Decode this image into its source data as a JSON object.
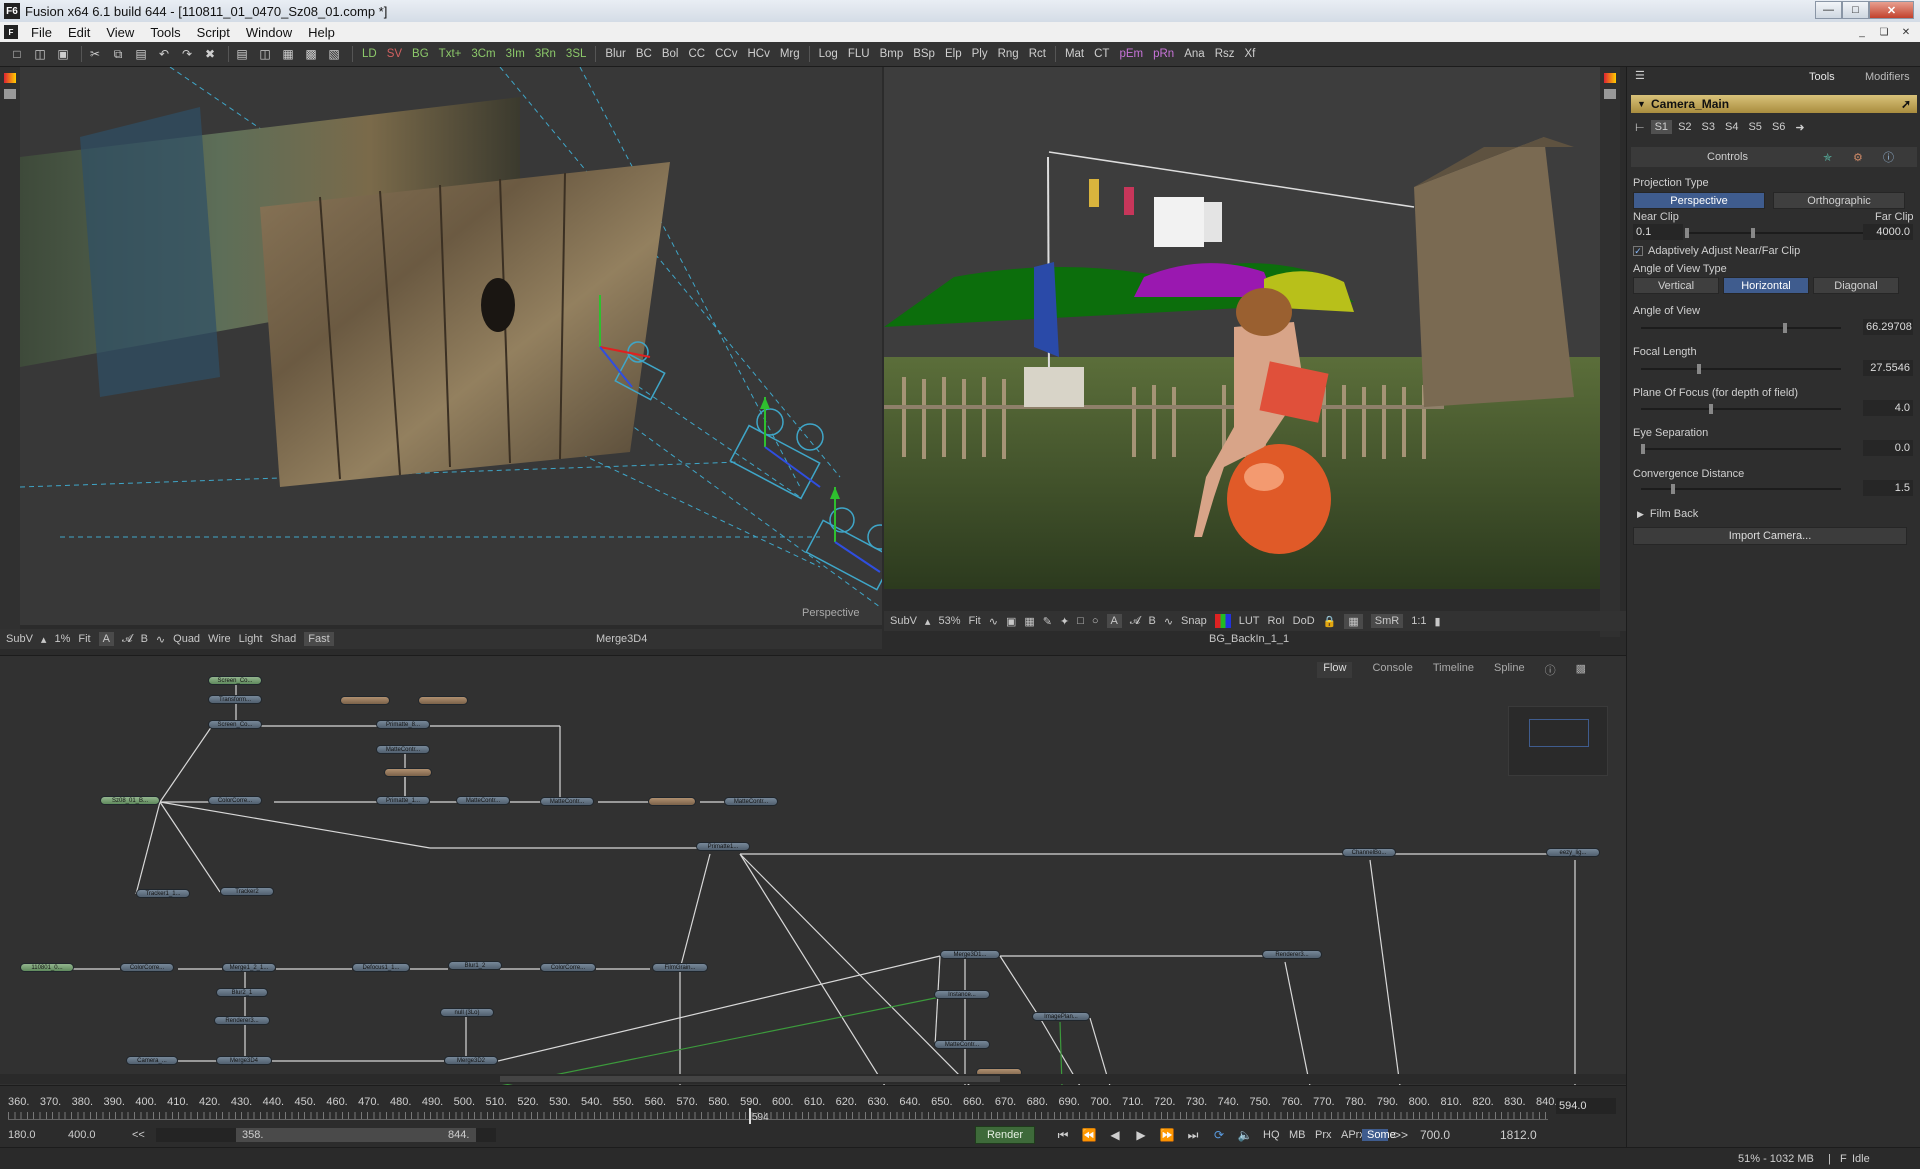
{
  "window": {
    "title": "Fusion x64 6.1 build 644 - [110811_01_0470_Sz08_01.comp *]",
    "app_icon": "F6"
  },
  "menu": [
    "File",
    "Edit",
    "View",
    "Tools",
    "Script",
    "Window",
    "Help"
  ],
  "toolbar": {
    "tools": [
      {
        "label": "LD",
        "tint": "green"
      },
      {
        "label": "SV",
        "tint": "red"
      },
      {
        "label": "BG",
        "tint": "green"
      },
      {
        "label": "Txt+",
        "tint": "green"
      },
      {
        "label": "3Cm",
        "tint": "green"
      },
      {
        "label": "3Im",
        "tint": "green"
      },
      {
        "label": "3Rn",
        "tint": "green"
      },
      {
        "label": "3SL",
        "tint": "green"
      },
      {
        "label": "Blur",
        "tint": ""
      },
      {
        "label": "BC",
        "tint": ""
      },
      {
        "label": "Bol",
        "tint": ""
      },
      {
        "label": "CC",
        "tint": ""
      },
      {
        "label": "CCv",
        "tint": ""
      },
      {
        "label": "HCv",
        "tint": ""
      },
      {
        "label": "Mrg",
        "tint": ""
      },
      {
        "label": "Log",
        "tint": ""
      },
      {
        "label": "FLU",
        "tint": ""
      },
      {
        "label": "Bmp",
        "tint": ""
      },
      {
        "label": "BSp",
        "tint": ""
      },
      {
        "label": "Elp",
        "tint": ""
      },
      {
        "label": "Ply",
        "tint": ""
      },
      {
        "label": "Rng",
        "tint": ""
      },
      {
        "label": "Rct",
        "tint": ""
      },
      {
        "label": "Mat",
        "tint": ""
      },
      {
        "label": "CT",
        "tint": ""
      },
      {
        "label": "pEm",
        "tint": "magenta"
      },
      {
        "label": "pRn",
        "tint": "magenta"
      },
      {
        "label": "Ana",
        "tint": ""
      },
      {
        "label": "Rsz",
        "tint": ""
      },
      {
        "label": "Xf",
        "tint": ""
      }
    ]
  },
  "viewer_left": {
    "label_perspective": "Perspective",
    "bar": {
      "subv": "SubV",
      "zoom": "1%",
      "fit": "Fit",
      "quad": "Quad",
      "wire": "Wire",
      "light": "Light",
      "shad": "Shad",
      "fast": "Fast"
    },
    "viewing": "Merge3D4"
  },
  "viewer_right": {
    "bar": {
      "subv": "SubV",
      "zoom": "53%",
      "fit": "Fit",
      "snap": "Snap",
      "lut": "LUT",
      "roi": "RoI",
      "dod": "DoD",
      "smr": "SmR",
      "ratio": "1:1"
    },
    "viewing": "BG_BackIn_1_1"
  },
  "panel": {
    "tabs": [
      "Tools",
      "Modifiers"
    ],
    "tool_name": "Camera_Main",
    "slots": [
      "S1",
      "S2",
      "S3",
      "S4",
      "S5",
      "S6"
    ],
    "controls_tab": "Controls",
    "projection_type": "Projection Type",
    "perspective": "Perspective",
    "orthographic": "Orthographic",
    "near_clip": "Near Clip",
    "far_clip": "Far Clip",
    "near_clip_value": "0.1",
    "far_clip_value": "4000.0",
    "adaptive": "Adaptively Adjust Near/Far Clip",
    "aov_type": "Angle of View Type",
    "vertical": "Vertical",
    "horizontal": "Horizontal",
    "diagonal": "Diagonal",
    "angle_of_view": "Angle of View",
    "angle_of_view_value": "66.29708",
    "focal_length": "Focal Length",
    "focal_length_value": "27.5546",
    "plane_of_focus": "Plane Of Focus (for depth of field)",
    "plane_of_focus_value": "4.0",
    "eye_separation": "Eye Separation",
    "eye_separation_value": "0.0",
    "convergence": "Convergence Distance",
    "convergence_value": "1.5",
    "film_back": "Film Back",
    "import_camera": "Import Camera..."
  },
  "flow": {
    "tabs": [
      "Flow",
      "Console",
      "Timeline",
      "Spline"
    ],
    "nodes": [
      {
        "label": "Screen_Co...",
        "tint": "green"
      },
      {
        "label": "Transform...",
        "tint": ""
      },
      {
        "label": "Screen_Co...",
        "tint": ""
      },
      {
        "label": "",
        "tint": "tan"
      },
      {
        "label": "",
        "tint": "tan"
      },
      {
        "label": "Primatte_8...",
        "tint": ""
      },
      {
        "label": "MatteContr...",
        "tint": ""
      },
      {
        "label": "",
        "tint": "tan"
      },
      {
        "label": "Sz08_01_B...",
        "tint": "green"
      },
      {
        "label": "ColorCorre...",
        "tint": ""
      },
      {
        "label": "Primatte_1...",
        "tint": ""
      },
      {
        "label": "MatteContr...",
        "tint": ""
      },
      {
        "label": "MatteContr...",
        "tint": ""
      },
      {
        "label": "",
        "tint": "tan"
      },
      {
        "label": "MatteContr...",
        "tint": ""
      },
      {
        "label": "Tracker1_1...",
        "tint": ""
      },
      {
        "label": "Tracker2",
        "tint": ""
      },
      {
        "label": "Primatte1...",
        "tint": ""
      },
      {
        "label": "ChannelBo...",
        "tint": ""
      },
      {
        "label": "eezy_lig...",
        "tint": ""
      },
      {
        "label": "110801_0...",
        "tint": "green"
      },
      {
        "label": "ColorCorre...",
        "tint": ""
      },
      {
        "label": "Merge1_2_1...",
        "tint": ""
      },
      {
        "label": "Defocus1_1...",
        "tint": ""
      },
      {
        "label": "Blur1_2",
        "tint": ""
      },
      {
        "label": "ColorCorre...",
        "tint": ""
      },
      {
        "label": "FilmGrain...",
        "tint": ""
      },
      {
        "label": "Merge3D1...",
        "tint": ""
      },
      {
        "label": "Renderer3...",
        "tint": ""
      },
      {
        "label": "Blur2_1",
        "tint": ""
      },
      {
        "label": "Instance...",
        "tint": ""
      },
      {
        "label": "Renderer3...",
        "tint": ""
      },
      {
        "label": "null (3Lo)",
        "tint": ""
      },
      {
        "label": "ImagePlan...",
        "tint": ""
      },
      {
        "label": "Camera_...",
        "tint": ""
      },
      {
        "label": "Merge3D4",
        "tint": ""
      },
      {
        "label": "Merge3D2",
        "tint": ""
      },
      {
        "label": "MatteContr...",
        "tint": ""
      },
      {
        "label": "",
        "tint": "tan"
      }
    ]
  },
  "timeline": {
    "ruler": [
      "360.",
      "370.",
      "380.",
      "390.",
      "400.",
      "410.",
      "420.",
      "430.",
      "440.",
      "450.",
      "460.",
      "470.",
      "480.",
      "490.",
      "500.",
      "510.",
      "520.",
      "530.",
      "540.",
      "550.",
      "560.",
      "570.",
      "580.",
      "590.",
      "600.",
      "610.",
      "620.",
      "630.",
      "640.",
      "650.",
      "660.",
      "670.",
      "680.",
      "690.",
      "700.",
      "710.",
      "720.",
      "730.",
      "740.",
      "750.",
      "760.",
      "770.",
      "780.",
      "790.",
      "800.",
      "810.",
      "820.",
      "830.",
      "840."
    ],
    "current_marker": "594",
    "current_field": "594.0",
    "global_start": "180.0",
    "render_start": "400.0",
    "range_start": "358.",
    "range_end": "844.",
    "render": "Render",
    "hq": "HQ",
    "mb": "MB",
    "prx": "Prx",
    "aprx": "APrx",
    "some": "Some",
    "render_end": "700.0",
    "global_end": "1812.0"
  },
  "status": {
    "memory": "51% - 1032 MB",
    "state": "Idle"
  }
}
